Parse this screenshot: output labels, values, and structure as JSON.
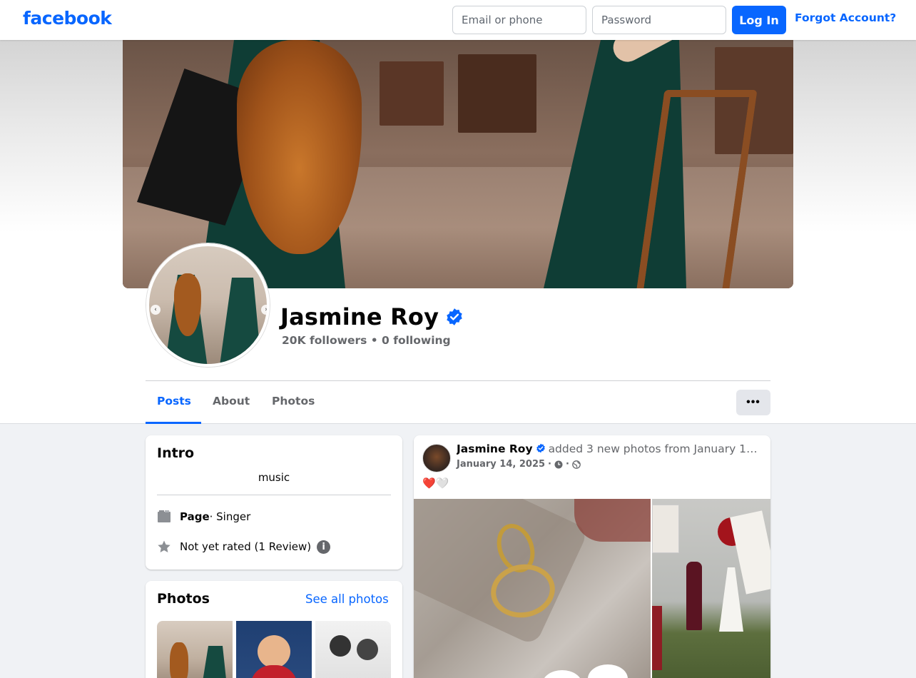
{
  "topbar": {
    "logo": "facebook",
    "email_placeholder": "Email or phone",
    "password_placeholder": "Password",
    "login_label": "Log In",
    "forgot_label": "Forgot Account?"
  },
  "profile": {
    "name": "Jasmine Roy",
    "stats": "20K followers • 0 following"
  },
  "tabs": [
    {
      "label": "Posts"
    },
    {
      "label": "About"
    },
    {
      "label": "Photos"
    }
  ],
  "more_label": "•••",
  "intro": {
    "title": "Intro",
    "bio": "music",
    "page_label": "Page",
    "page_category": " · Singer",
    "rating": "Not yet rated (1 Review)"
  },
  "photos_card": {
    "title": "Photos",
    "see_all": "See all photos"
  },
  "post": {
    "author": "Jasmine Roy",
    "action": "added 3 new photos from January 14, 2025",
    "date": "January 14, 2025",
    "text": "❤️🤍"
  },
  "colors": {
    "brand": "#0866ff",
    "secondary_text": "#65676b",
    "background": "#f0f2f5"
  },
  "icons": [
    "verified-badge-icon",
    "page-flag-icon",
    "star-icon",
    "info-icon",
    "clock-icon",
    "globe-icon",
    "more-dots-icon"
  ]
}
